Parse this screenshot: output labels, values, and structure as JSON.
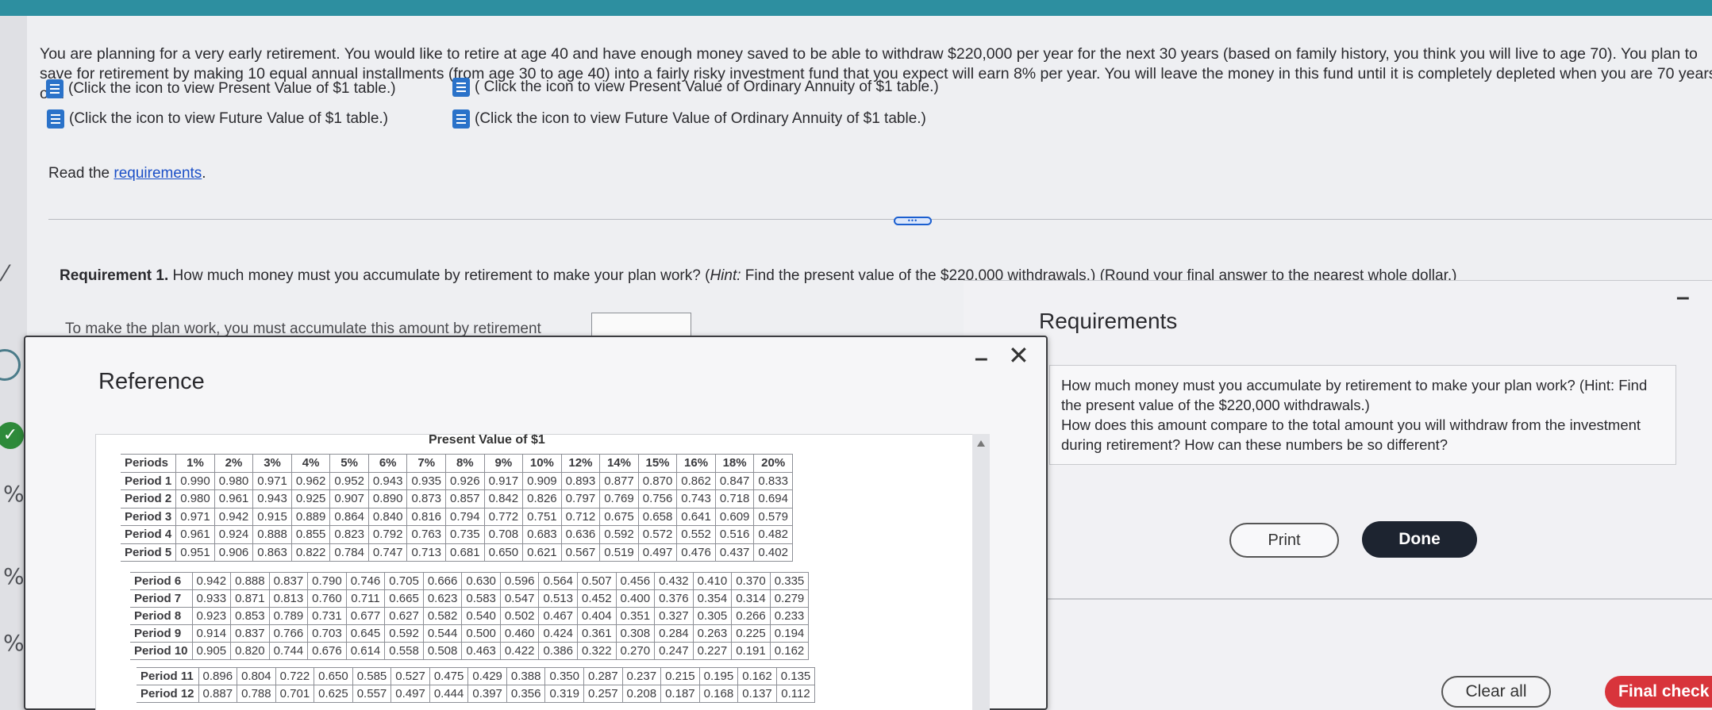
{
  "problem": {
    "intro": "You are planning for a very early retirement. You would like to retire at age 40 and have enough money saved to be able to withdraw $220,000 per year for the next 30 years (based on family history, you think you will live to age 70). You plan to save for retirement by making 10 equal annual installments (from age 30 to age 40) into a fairly risky investment fund that you expect will earn 8% per year. You will leave the money in this fund until it is completely depleted when you are 70 years old."
  },
  "links": {
    "pv": "(Click the icon to view Present Value of $1 table.)",
    "fv": "(Click the icon to view Future Value of $1 table.)",
    "pvoa": "( Click the icon to view Present Value of Ordinary Annuity of $1 table.)",
    "fvoa": "(Click the icon to view Future Value of Ordinary Annuity of $1 table.)",
    "read_prefix": "Read the ",
    "read_link": "requirements",
    "read_suffix": "."
  },
  "more_button": "•••",
  "requirement1": {
    "label": "Requirement 1.",
    "text": " How much money must you accumulate by retirement to make your plan work? (",
    "hint": "Hint:",
    "text2": " Find the present value of the $220,000 withdrawals.) (Round your final answer to the nearest whole dollar.)",
    "answer_prompt": "To make the plan work, you must accumulate this amount by retirement",
    "answer_value": ""
  },
  "reference": {
    "title": "Reference",
    "minimize": "–",
    "close": "✕",
    "table_title": "Present Value of $1",
    "columns": [
      "Periods",
      "1%",
      "2%",
      "3%",
      "4%",
      "5%",
      "6%",
      "7%",
      "8%",
      "9%",
      "10%",
      "12%",
      "14%",
      "15%",
      "16%",
      "18%",
      "20%"
    ],
    "rows_a": [
      [
        "Period 1",
        "0.990",
        "0.980",
        "0.971",
        "0.962",
        "0.952",
        "0.943",
        "0.935",
        "0.926",
        "0.917",
        "0.909",
        "0.893",
        "0.877",
        "0.870",
        "0.862",
        "0.847",
        "0.833"
      ],
      [
        "Period 2",
        "0.980",
        "0.961",
        "0.943",
        "0.925",
        "0.907",
        "0.890",
        "0.873",
        "0.857",
        "0.842",
        "0.826",
        "0.797",
        "0.769",
        "0.756",
        "0.743",
        "0.718",
        "0.694"
      ],
      [
        "Period 3",
        "0.971",
        "0.942",
        "0.915",
        "0.889",
        "0.864",
        "0.840",
        "0.816",
        "0.794",
        "0.772",
        "0.751",
        "0.712",
        "0.675",
        "0.658",
        "0.641",
        "0.609",
        "0.579"
      ],
      [
        "Period 4",
        "0.961",
        "0.924",
        "0.888",
        "0.855",
        "0.823",
        "0.792",
        "0.763",
        "0.735",
        "0.708",
        "0.683",
        "0.636",
        "0.592",
        "0.572",
        "0.552",
        "0.516",
        "0.482"
      ],
      [
        "Period 5",
        "0.951",
        "0.906",
        "0.863",
        "0.822",
        "0.784",
        "0.747",
        "0.713",
        "0.681",
        "0.650",
        "0.621",
        "0.567",
        "0.519",
        "0.497",
        "0.476",
        "0.437",
        "0.402"
      ]
    ],
    "rows_b": [
      [
        "Period 6",
        "0.942",
        "0.888",
        "0.837",
        "0.790",
        "0.746",
        "0.705",
        "0.666",
        "0.630",
        "0.596",
        "0.564",
        "0.507",
        "0.456",
        "0.432",
        "0.410",
        "0.370",
        "0.335"
      ],
      [
        "Period 7",
        "0.933",
        "0.871",
        "0.813",
        "0.760",
        "0.711",
        "0.665",
        "0.623",
        "0.583",
        "0.547",
        "0.513",
        "0.452",
        "0.400",
        "0.376",
        "0.354",
        "0.314",
        "0.279"
      ],
      [
        "Period 8",
        "0.923",
        "0.853",
        "0.789",
        "0.731",
        "0.677",
        "0.627",
        "0.582",
        "0.540",
        "0.502",
        "0.467",
        "0.404",
        "0.351",
        "0.327",
        "0.305",
        "0.266",
        "0.233"
      ],
      [
        "Period 9",
        "0.914",
        "0.837",
        "0.766",
        "0.703",
        "0.645",
        "0.592",
        "0.544",
        "0.500",
        "0.460",
        "0.424",
        "0.361",
        "0.308",
        "0.284",
        "0.263",
        "0.225",
        "0.194"
      ],
      [
        "Period 10",
        "0.905",
        "0.820",
        "0.744",
        "0.676",
        "0.614",
        "0.558",
        "0.508",
        "0.463",
        "0.422",
        "0.386",
        "0.322",
        "0.270",
        "0.247",
        "0.227",
        "0.191",
        "0.162"
      ]
    ],
    "rows_c": [
      [
        "Period 11",
        "0.896",
        "0.804",
        "0.722",
        "0.650",
        "0.585",
        "0.527",
        "0.475",
        "0.429",
        "0.388",
        "0.350",
        "0.287",
        "0.237",
        "0.215",
        "0.195",
        "0.162",
        "0.135"
      ],
      [
        "Period 12",
        "0.887",
        "0.788",
        "0.701",
        "0.625",
        "0.557",
        "0.497",
        "0.444",
        "0.397",
        "0.356",
        "0.319",
        "0.257",
        "0.208",
        "0.187",
        "0.168",
        "0.137",
        "0.112"
      ]
    ]
  },
  "requirements_panel": {
    "title": "Requirements",
    "minimize": "–",
    "items_text": "How much money must you accumulate by retirement to make your plan work? (Hint: Find the present value of the $220,000 withdrawals.)",
    "items_text2": "How does this amount compare to the total amount you will withdraw from the investment during retirement? How can these numbers be so different?",
    "print": "Print",
    "done": "Done"
  },
  "footer": {
    "clear_all": "Clear all",
    "final_check": "Final check"
  }
}
